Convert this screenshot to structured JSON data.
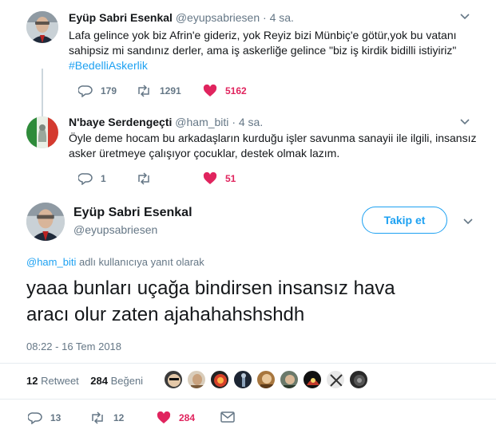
{
  "reply_tweet_1": {
    "name": "Eyüp Sabri Esenkal",
    "handle": "@eyupsabriesen",
    "time": "4 sa.",
    "text_line1": "Lafa gelince yok biz Afrin'e gideriz, yok Reyiz bizi Münbiç'e götür,yok bu vatanı",
    "text_line2": "sahipsiz mi sandınız derler, ama iş askerliğe gelince \"biz iş kirdik bidilli istiyiriz\"",
    "hashtag": "#BedelliAskerlik",
    "replies": "179",
    "retweets": "1291",
    "likes": "5162"
  },
  "reply_tweet_2": {
    "name": "N'baye Serdengeçti",
    "handle": "@ham_biti",
    "time": "4 sa.",
    "text_line1": "Öyle deme hocam bu arkadaşların kurduğu işler savunma sanayii ile ilgili, insansız",
    "text_line2": "asker üretmeye çalışıyor çocuklar, destek olmak lazım.",
    "replies": "1",
    "retweets": "",
    "likes": "51"
  },
  "main_tweet": {
    "name": "Eyüp Sabri Esenkal",
    "handle": "@eyupsabriesen",
    "follow_label": "Takip et",
    "reply_to_handle": "@ham_biti",
    "reply_to_suffix": "adlı kullanıcıya yanıt olarak",
    "text_line1": "yaaa bunları uçağa bindirsen insansız hava",
    "text_line2": "aracı olur zaten ajahahahshshdh",
    "timestamp": "08:22 - 16 Tem 2018",
    "retweet_count": "12",
    "retweet_label": "Retweet",
    "like_count": "284",
    "like_label": "Beğeni",
    "replies": "13",
    "retweets": "12",
    "likes": "284"
  },
  "likers_count_shown": 9,
  "colors": {
    "accent": "#1da1f2",
    "like": "#e0245e",
    "muted": "#657786",
    "text": "#14171a",
    "border": "#e6ecf0"
  },
  "icons": {
    "reply": "reply-icon",
    "retweet": "retweet-icon",
    "like": "heart-icon",
    "dm": "envelope-icon",
    "caret": "chevron-down-icon"
  }
}
